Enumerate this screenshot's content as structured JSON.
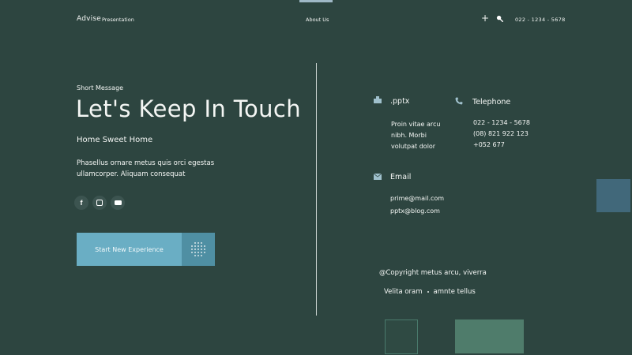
{
  "header": {
    "brand": "Advise",
    "nav_presentation": "Presentation",
    "nav_about": "About Us",
    "plus_glyph": "+",
    "phone": "022 - 1234 - 5678"
  },
  "hero": {
    "short_message": "Short Message",
    "title": "Let's Keep In Touch",
    "subtitle": "Home Sweet Home",
    "body_line1": "Phasellus ornare metus quis orci egestas",
    "body_line2": "ullamcorper. Aliquam consequat",
    "social": [
      "facebook-icon",
      "instagram-icon",
      "youtube-icon"
    ],
    "facebook_glyph": "f",
    "cta_label": "Start New Experience"
  },
  "contact": {
    "pptx": {
      "title": ".pptx",
      "lines": [
        "Proin vitae arcu",
        "nibh. Morbi",
        "volutpat dolor"
      ]
    },
    "telephone": {
      "title": "Telephone",
      "lines": [
        "022 - 1234 - 5678",
        "(08) 821 922 123",
        "+052 677"
      ]
    },
    "email": {
      "title": "Email",
      "lines": [
        "prime@mail.com",
        "pptx@blog.com"
      ]
    }
  },
  "footer": {
    "copyright": "@Copyright metus arcu, viverra",
    "link1": "Velita oram",
    "link2": "amnte tellus"
  },
  "colors": {
    "background": "#2d4540",
    "accent_blue": "#6aaec4",
    "accent_blue_dark": "#4f8fa3",
    "deco_blue": "#41687a",
    "deco_green": "#4f7c6b",
    "icon_tint": "#9fc0cc"
  }
}
